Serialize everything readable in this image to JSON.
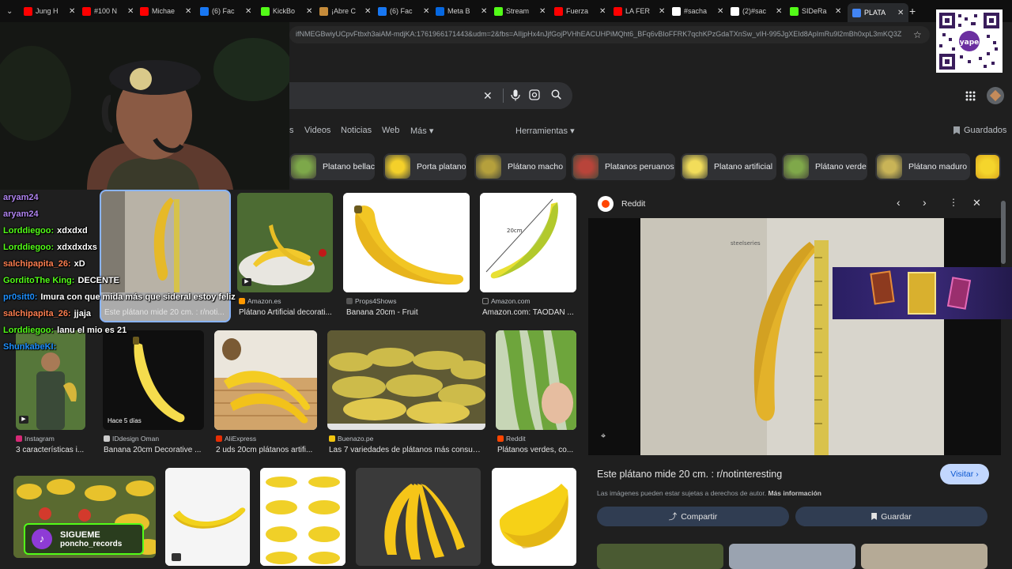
{
  "tabs": [
    {
      "label": "Jung H",
      "color": "#ff0000"
    },
    {
      "label": "#100 N",
      "color": "#ff0000"
    },
    {
      "label": "Michae",
      "color": "#ff0000"
    },
    {
      "label": "(6) Fac",
      "color": "#1877f2"
    },
    {
      "label": "KickBo",
      "color": "#53fc18"
    },
    {
      "label": "¡Abre C",
      "color": "#c58b3a"
    },
    {
      "label": "(6) Fac",
      "color": "#1877f2"
    },
    {
      "label": "Meta B",
      "color": "#0668e1"
    },
    {
      "label": "Stream",
      "color": "#53fc18"
    },
    {
      "label": "Fuerza",
      "color": "#ff0000"
    },
    {
      "label": "LA FER",
      "color": "#ff0000"
    },
    {
      "label": "#sacha",
      "color": "#ffffff"
    },
    {
      "label": "(2)#sac",
      "color": "#ffffff"
    },
    {
      "label": "SIDeRa",
      "color": "#53fc18"
    },
    {
      "label": "PLATA",
      "color": "#4285f4"
    }
  ],
  "new_tab_symbol": "+",
  "address_url": "ifNMEGBwiyUCpvFtbxh3aiAM-mdjKA:1761966171443&udm=2&fbs=AIIjpHx4nJjfGojPVHhEACUHPiMQht6_BFq6vBIoFFRK7qchKPzGdaTXnSw_vIH-995JgXEId8ApImRu9l2mBh0xpL3mKQ3Z",
  "nav": {
    "links": [
      "s",
      "Videos",
      "Noticias",
      "Web",
      "Más ▾"
    ],
    "tools": "Herramientas ▾",
    "saved": "Guardados"
  },
  "chips": [
    {
      "label": "Platano bellaco",
      "color": "#7da84a"
    },
    {
      "label": "Porta platano",
      "color": "#f4d02a"
    },
    {
      "label": "Plátano macho",
      "color": "#b5a03c"
    },
    {
      "label": "Platanos peruanos",
      "color": "#b8443a"
    },
    {
      "label": "Platano artificial",
      "color": "#f2dd5a"
    },
    {
      "label": "Plátano verde",
      "color": "#7fa84a"
    },
    {
      "label": "Plátano maduro",
      "color": "#c9b457"
    }
  ],
  "row1": [
    {
      "source": "",
      "caption": "Este plátano mide 20 cm. : r/noti..."
    },
    {
      "source": "Amazon.es",
      "caption": "Plátano Artificial decorati..."
    },
    {
      "source": "Props4Shows",
      "caption": "Banana 20cm - Fruit"
    },
    {
      "source": "Amazon.com",
      "caption": "Amazon.com: TAODAN ..."
    }
  ],
  "row1_ruler_label": "20cm",
  "row2": [
    {
      "source": "Instagram",
      "caption": "3 características i..."
    },
    {
      "source": "IDdesign Oman",
      "caption": "Banana 20cm Decorative ..."
    },
    {
      "source": "AliExpress",
      "caption": "2 uds 20cm plátanos artifi..."
    },
    {
      "source": "Buenazo.pe",
      "caption": "Las 7 variedades de plátanos más consum..."
    },
    {
      "source": "Reddit",
      "caption": "Plátanos verdes, co..."
    }
  ],
  "row2_badge": "Hace 5 días",
  "chat": [
    {
      "user": "aryam24",
      "msg": "",
      "color": "#b084f0"
    },
    {
      "user": "aryam24",
      "msg": "",
      "color": "#b084f0"
    },
    {
      "user": "Lorddiegoo:",
      "msg": "xdxdxd",
      "color": "#53fc18"
    },
    {
      "user": "Lorddiegoo:",
      "msg": "xdxdxdxs",
      "color": "#53fc18"
    },
    {
      "user": "salchipapita_26:",
      "msg": "xD",
      "color": "#ff7f50"
    },
    {
      "user": "GorditoThe King:",
      "msg": "DECENTE",
      "color": "#53fc18"
    },
    {
      "user": "pr0sitt0:",
      "msg": "Imura con que mida más que sideral estoy feliz",
      "color": "#1e90ff"
    },
    {
      "user": "salchipapita_26:",
      "msg": "jjaja",
      "color": "#ff7f50"
    },
    {
      "user": "Lorddiegoo:",
      "msg": "lanu el mio es 21",
      "color": "#53fc18"
    },
    {
      "user": "ShunkabeKI:",
      "msg": "",
      "color": "#1e90ff"
    }
  ],
  "follow": {
    "title": "SIGUEME",
    "handle": "poncho_records"
  },
  "panel": {
    "site": "Reddit",
    "title": "Este plátano mide 20 cm. : r/notinteresting",
    "visit": "Visitar",
    "notice": "Las imágenes pueden estar sujetas a derechos de autor.",
    "notice_link": "Más información",
    "share": "Compartir",
    "save": "Guardar",
    "overlay_text": "steelseries"
  },
  "colors": {
    "accent": "#8ab4f8",
    "button_blue_bg": "#c2d7fe",
    "banana": "#f4cf2b"
  }
}
